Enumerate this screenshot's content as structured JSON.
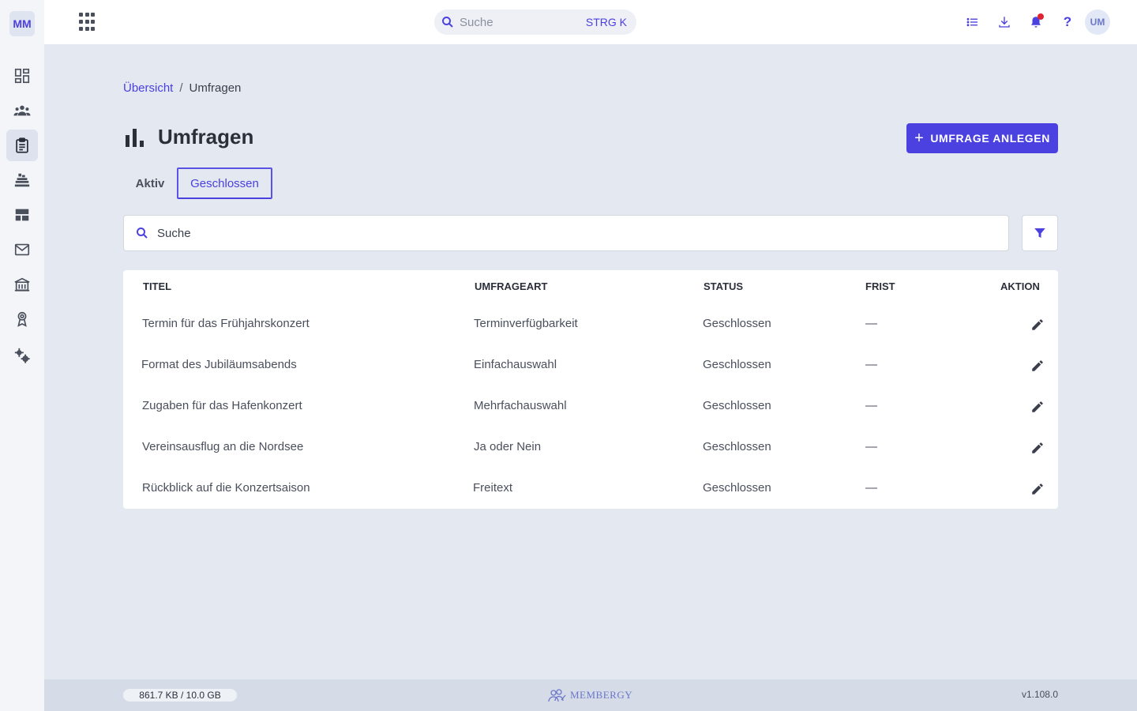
{
  "sidebar": {
    "org_badge": "MM",
    "items": [
      {
        "name": "dashboard",
        "icon": "dashboard-icon"
      },
      {
        "name": "members",
        "icon": "group-icon"
      },
      {
        "name": "surveys",
        "icon": "clipboard-icon",
        "active": true
      },
      {
        "name": "inventory",
        "icon": "inventory-icon"
      },
      {
        "name": "groups",
        "icon": "table-icon"
      },
      {
        "name": "mail",
        "icon": "mail-icon"
      },
      {
        "name": "organization",
        "icon": "building-icon"
      },
      {
        "name": "awards",
        "icon": "award-icon"
      },
      {
        "name": "settings",
        "icon": "gears-icon"
      }
    ]
  },
  "topbar": {
    "search_placeholder": "Suche",
    "search_shortcut": "STRG K",
    "help_label": "?",
    "avatar_initials": "UM"
  },
  "breadcrumb": {
    "home": "Übersicht",
    "separator": "/",
    "current": "Umfragen"
  },
  "page": {
    "title": "Umfragen",
    "create_button": "UMFRAGE ANLEGEN",
    "create_button_plus": "+"
  },
  "tabs": [
    {
      "label": "Aktiv",
      "selected": false
    },
    {
      "label": "Geschlossen",
      "selected": true
    }
  ],
  "filter": {
    "search_value": "Suche"
  },
  "table": {
    "columns": [
      "TITEL",
      "UMFRAGEART",
      "STATUS",
      "FRIST",
      "AKTION"
    ],
    "rows": [
      {
        "title": "Termin für das Frühjahrskonzert",
        "type": "Terminverfügbarkeit",
        "status": "Geschlossen",
        "deadline": "—"
      },
      {
        "title": "Format des Jubiläumsabends",
        "type": "Einfachauswahl",
        "status": "Geschlossen",
        "deadline": "—"
      },
      {
        "title": "Zugaben für das Hafenkonzert",
        "type": "Mehrfachauswahl",
        "status": "Geschlossen",
        "deadline": "—"
      },
      {
        "title": "Vereinsausflug an die Nordsee",
        "type": "Ja oder Nein",
        "status": "Geschlossen",
        "deadline": "—"
      },
      {
        "title": "Rückblick auf die Konzertsaison",
        "type": "Freitext",
        "status": "Geschlossen",
        "deadline": "—"
      }
    ]
  },
  "footer": {
    "storage": "861.7 KB / 10.0 GB",
    "brand": "MEMBERGY",
    "version": "v1.108.0"
  },
  "colors": {
    "accent": "#4b40e0",
    "background": "#e4e8f0",
    "notification": "#e0242f"
  }
}
